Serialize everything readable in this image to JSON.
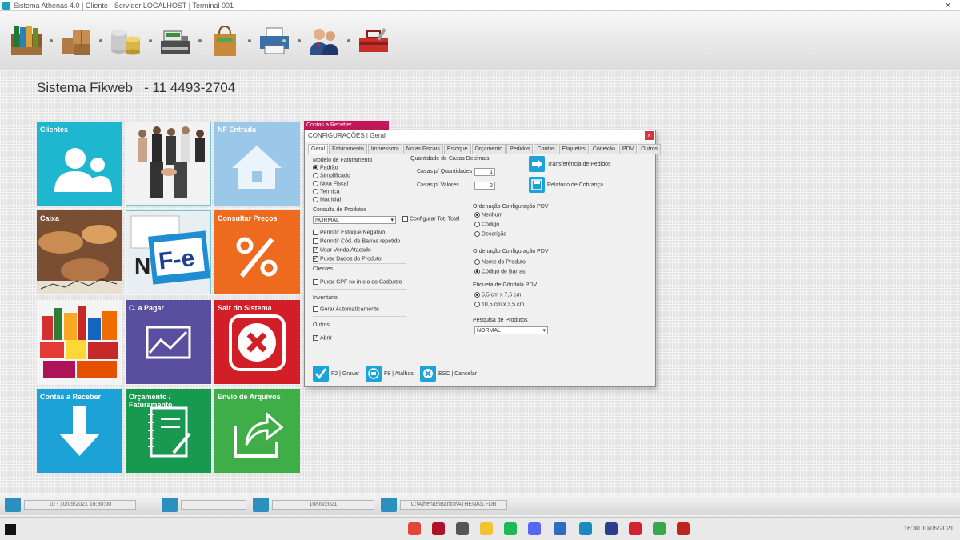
{
  "window": {
    "title": "Sistema Athenas 4.0 | Cliente · Servidor LOCALHOST | Terminal 001",
    "close_glyph": "×"
  },
  "toolbar": {
    "items": [
      {
        "name": "toolbar-cadastros-button",
        "icon": "folders-icon"
      },
      {
        "name": "toolbar-estoque-button",
        "icon": "boxes-icon"
      },
      {
        "name": "toolbar-financeiro-button",
        "icon": "coins-icon"
      },
      {
        "name": "toolbar-caixa-button",
        "icon": "cash-register-icon"
      },
      {
        "name": "toolbar-compras-button",
        "icon": "shopping-bag-icon"
      },
      {
        "name": "toolbar-impressao-button",
        "icon": "printer-icon"
      },
      {
        "name": "toolbar-usuarios-button",
        "icon": "users-icon"
      },
      {
        "name": "toolbar-ferramentas-button",
        "icon": "toolbox-icon"
      }
    ]
  },
  "header": {
    "system_name": "Sistema Fikweb",
    "phone": "- 11 4493-2704"
  },
  "tiles": [
    {
      "label": "Clientes",
      "color": "#1fb6d0",
      "icon": "users-icon"
    },
    {
      "label": "",
      "color": "#f0f0f0",
      "icon": "business-people-photo"
    },
    {
      "label": "NF Entrada",
      "color": "#9bc7e8",
      "icon": "house-icon"
    },
    {
      "label": "Caixa",
      "color": "#8a5a3a",
      "icon": "coins-photo"
    },
    {
      "label": "",
      "color": "#d6e8f2",
      "icon": "nfe-photo"
    },
    {
      "label": "Consultar Preços",
      "color": "#ee6a1e",
      "icon": "percent-icon"
    },
    {
      "label": "",
      "color": "#d0312d",
      "icon": "products-photo"
    },
    {
      "label": "C. a Pagar",
      "color": "#5a4e9e",
      "icon": "chart-icon"
    },
    {
      "label": "Sair do Sistema",
      "color": "#d21e26",
      "icon": "close-icon"
    },
    {
      "label": "Contas a Receber",
      "color": "#1da2d8",
      "icon": "arrow-down-icon"
    },
    {
      "label": "Orçamento / Faturamento",
      "color": "#179a4f",
      "icon": "notebook-icon"
    },
    {
      "label": "Envio de Arquivos",
      "color": "#3fae49",
      "icon": "share-icon"
    }
  ],
  "dialog": {
    "header_label": "Contas a Receber",
    "title": "CONFIGURAÇÕES | Geral",
    "close_glyph": "×",
    "tabs": [
      "Geral",
      "Faturamento",
      "Impressora",
      "Notas Fiscais",
      "Estoque",
      "Orçamento",
      "Pedidos",
      "Contas",
      "Etiquetas",
      "Conexão",
      "PDV",
      "Outros"
    ],
    "formato_label": "Modelo de Faturamento",
    "formato_options": [
      {
        "label": "Padrão",
        "selected": true
      },
      {
        "label": "Simplificado",
        "selected": false
      },
      {
        "label": "Nota Fiscal",
        "selected": false
      },
      {
        "label": "Termica",
        "selected": false
      },
      {
        "label": "Matricial",
        "selected": false
      }
    ],
    "casas_label": "Quantidade de Casas Decimais",
    "qtd_label": "Casas p/ Quantidades",
    "qtd_value": "1",
    "val_label": "Casas p/ Valores",
    "val_value": "2",
    "btn_transferencia": "Transferência de Pedidos",
    "btn_relatorio": "Relatório de Cobrança",
    "consulta_label": "Consulta de Produtos",
    "consulta_value": "NORMAL",
    "config_total_label": "Configurar Tot. Total",
    "checks": [
      {
        "label": "Permitir Estoque Negativo",
        "checked": false
      },
      {
        "label": "Permitir Cód. de Barras repetido",
        "checked": false
      },
      {
        "label": "Usar Venda Atacado",
        "checked": true
      },
      {
        "label": "Puxar Dados do Produto",
        "checked": true
      }
    ],
    "clientes_label": "Clientes",
    "clientes_check": "Puxar CPF no início do Cadastro",
    "inventario_label": "Inventário",
    "inventario_check": "Gerar Automaticamente",
    "outros_label": "Outros",
    "outros_check": "Abrir",
    "ordem1_label": "Ordenação Configuração PDV",
    "ordem1_options": [
      {
        "label": "Nenhum",
        "selected": true
      },
      {
        "label": "Código",
        "selected": false
      },
      {
        "label": "Descrição",
        "selected": false
      }
    ],
    "ordem2_label": "Ordenação Configuração PDV",
    "ordem2_options": [
      {
        "label": "Nome do Produto",
        "selected": false
      },
      {
        "label": "Código de Barras",
        "selected": true
      }
    ],
    "etiqueta_label": "Etiqueta de Gôndola PDV",
    "etiqueta_options": [
      {
        "label": "5,5 cm x 7,5 cm",
        "selected": true
      },
      {
        "label": "10,5 cm x 3,5 cm",
        "selected": false
      }
    ],
    "pesquisa_label": "Pesquisa de Produtos",
    "pesquisa_value": "NORMAL",
    "btn_gravar": "F2 | Gravar",
    "btn_atalhos": "F8 | Atalhos",
    "btn_cancelar": "ESC | Cancelar"
  },
  "statusbar": {
    "field1": "10 - 10/05/2021 16:30:00",
    "field2": "",
    "field3": "10/05/2021",
    "field4": "C:\\Athenas\\Banco\\ATHENAS.FDB"
  },
  "taskbar": {
    "clock": "16:30 10/05/2021",
    "apps": [
      {
        "icon": "chrome-icon",
        "color": "#e2453a"
      },
      {
        "icon": "app-icon",
        "color": "#b0122a"
      },
      {
        "icon": "notepad-icon",
        "color": "#555555"
      },
      {
        "icon": "folder-icon",
        "color": "#f2c230"
      },
      {
        "icon": "spotify-icon",
        "color": "#1db954"
      },
      {
        "icon": "discord-icon",
        "color": "#5865f2"
      },
      {
        "icon": "visual-studio-icon",
        "color": "#2b6cc4"
      },
      {
        "icon": "athenas-icon",
        "color": "#1b8bbf"
      },
      {
        "icon": "vpn-icon",
        "color": "#2a3f8f"
      },
      {
        "icon": "media-icon",
        "color": "#d0232d"
      },
      {
        "icon": "browser-icon",
        "color": "#3aa84a"
      },
      {
        "icon": "game-icon",
        "color": "#c0241f"
      }
    ]
  }
}
